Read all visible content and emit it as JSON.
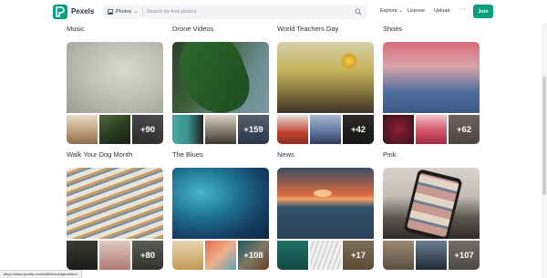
{
  "header": {
    "logo_text": "Pexels",
    "search": {
      "type_label": "Photos",
      "placeholder": "Search for free photos"
    },
    "nav": {
      "explore": "Explore",
      "license": "License",
      "upload": "Upload",
      "more": "···"
    },
    "join_label": "Join"
  },
  "collections": [
    {
      "title": "Music",
      "count": "+90"
    },
    {
      "title": "Drone Videos",
      "count": "+159"
    },
    {
      "title": "World Teachers Day",
      "count": "+42"
    },
    {
      "title": "Shoes",
      "count": "+62"
    },
    {
      "title": "Walk Your Dog Month",
      "count": "+80"
    },
    {
      "title": "The Blues",
      "count": "+108"
    },
    {
      "title": "News",
      "count": "+17"
    },
    {
      "title": "Pink",
      "count": "+107"
    }
  ],
  "status_url": "https://www.pexels.com/collections/fgbxdkwu/",
  "colors": {
    "brand": "#05a081",
    "text": "#2c343e"
  }
}
